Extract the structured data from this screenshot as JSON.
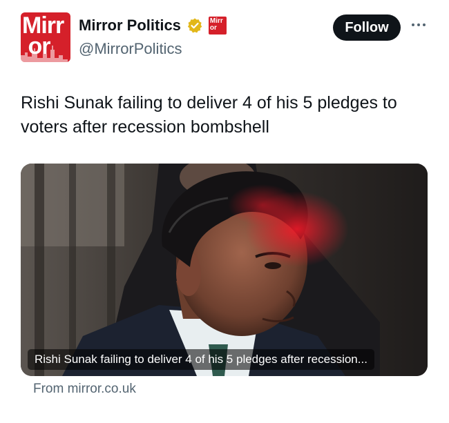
{
  "account": {
    "logo_text": "Mirr or",
    "mini_logo_text": "Mirr or",
    "display_name": "Mirror Politics",
    "handle": "@MirrorPolitics",
    "follow_label": "Follow"
  },
  "tweet": {
    "text": "Rishi Sunak failing to deliver 4 of his 5 pledges to voters after recession bombshell"
  },
  "card": {
    "caption": "Rishi Sunak failing to deliver 4 of his 5 pledges after recession...",
    "source": "From mirror.co.uk"
  },
  "icons": [
    "verified-badge-icon",
    "more-options-icon"
  ],
  "colors": {
    "brand_red": "#d5202a",
    "verified_gold": "#e2b719",
    "text_primary": "#0f1419",
    "text_secondary": "#536471",
    "button_bg": "#0f1419"
  }
}
